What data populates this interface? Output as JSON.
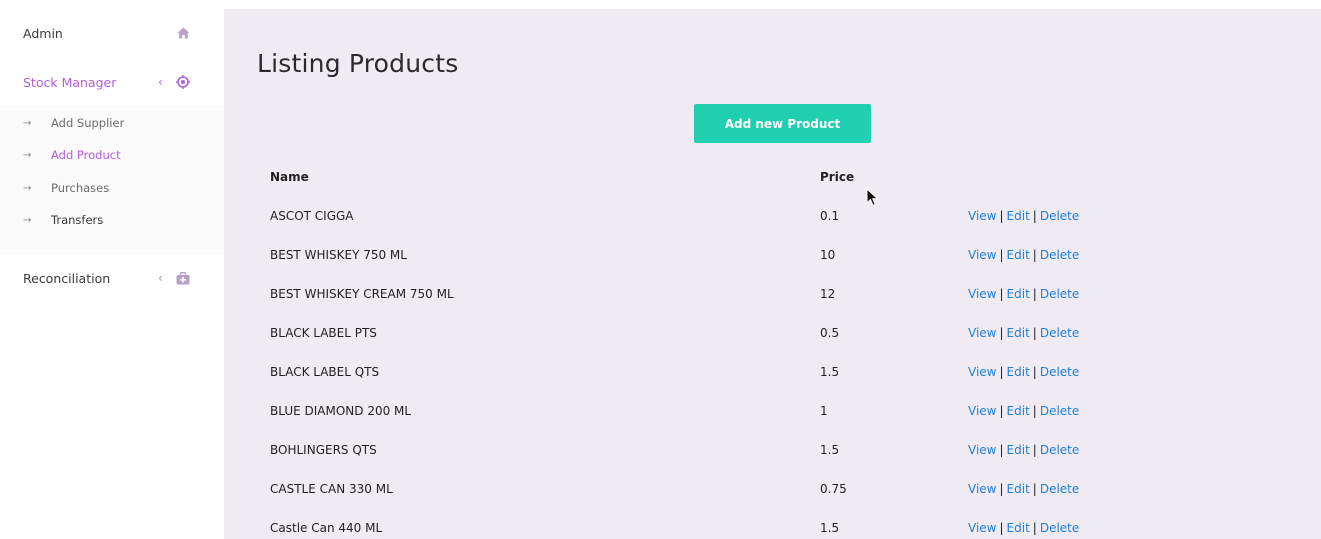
{
  "sidebar": {
    "admin": {
      "label": "Admin",
      "icon": "home-icon"
    },
    "stock_manager": {
      "label": "Stock Manager",
      "icon": "target-icon",
      "chevron": "‹"
    },
    "submenu": [
      {
        "label": "Add Supplier",
        "arrow": "→"
      },
      {
        "label": "Add Product",
        "arrow": "→"
      },
      {
        "label": "Purchases",
        "arrow": "→"
      },
      {
        "label": "Transfers",
        "arrow": "→"
      }
    ],
    "reconciliation": {
      "label": "Reconciliation",
      "icon": "medkit-icon",
      "chevron": "‹"
    }
  },
  "main": {
    "title": "Listing Products",
    "add_button": "Add new Product",
    "table": {
      "headers": {
        "name": "Name",
        "price": "Price"
      },
      "rows": [
        {
          "name": "ASCOT CIGGA",
          "price": "0.1"
        },
        {
          "name": "BEST WHISKEY 750 ML",
          "price": "10"
        },
        {
          "name": "BEST WHISKEY CREAM 750 ML",
          "price": "12"
        },
        {
          "name": "BLACK LABEL PTS",
          "price": "0.5"
        },
        {
          "name": "BLACK LABEL QTS",
          "price": "1.5"
        },
        {
          "name": "BLUE DIAMOND 200 ML",
          "price": "1"
        },
        {
          "name": "BOHLINGERS QTS",
          "price": "1.5"
        },
        {
          "name": "CASTLE CAN 330 ML",
          "price": "0.75"
        },
        {
          "name": "Castle Can 440 ML",
          "price": "1.5"
        }
      ],
      "actions": {
        "view": "View",
        "edit": "Edit",
        "delete": "Delete",
        "separator": "|"
      }
    }
  },
  "colors": {
    "accent": "#b35fd6",
    "button": "#1fcfb0",
    "link": "#1e7fd8",
    "main_bg": "#f0ebf2"
  }
}
